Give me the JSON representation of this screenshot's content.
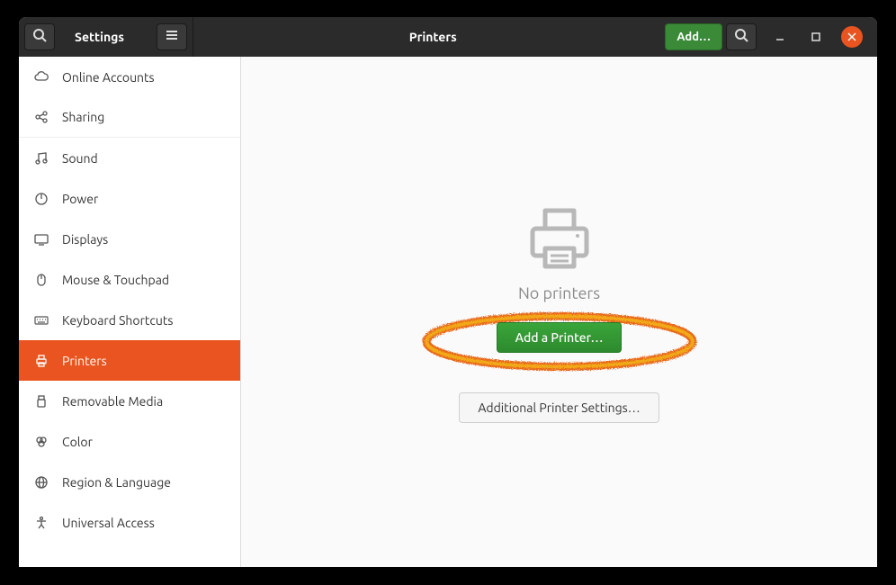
{
  "header": {
    "settings_title": "Settings",
    "page_title": "Printers",
    "add_label": "Add…"
  },
  "sidebar": {
    "items": [
      {
        "label": "Online Accounts"
      },
      {
        "label": "Sharing"
      },
      {
        "label": "Sound"
      },
      {
        "label": "Power"
      },
      {
        "label": "Displays"
      },
      {
        "label": "Mouse & Touchpad"
      },
      {
        "label": "Keyboard Shortcuts"
      },
      {
        "label": "Printers"
      },
      {
        "label": "Removable Media"
      },
      {
        "label": "Color"
      },
      {
        "label": "Region & Language"
      },
      {
        "label": "Universal Access"
      }
    ]
  },
  "content": {
    "empty_text": "No printers",
    "add_printer_label": "Add a Printer…",
    "additional_settings_label": "Additional Printer Settings…"
  },
  "annotation": {
    "highlighted_element": "add-printer-button"
  }
}
